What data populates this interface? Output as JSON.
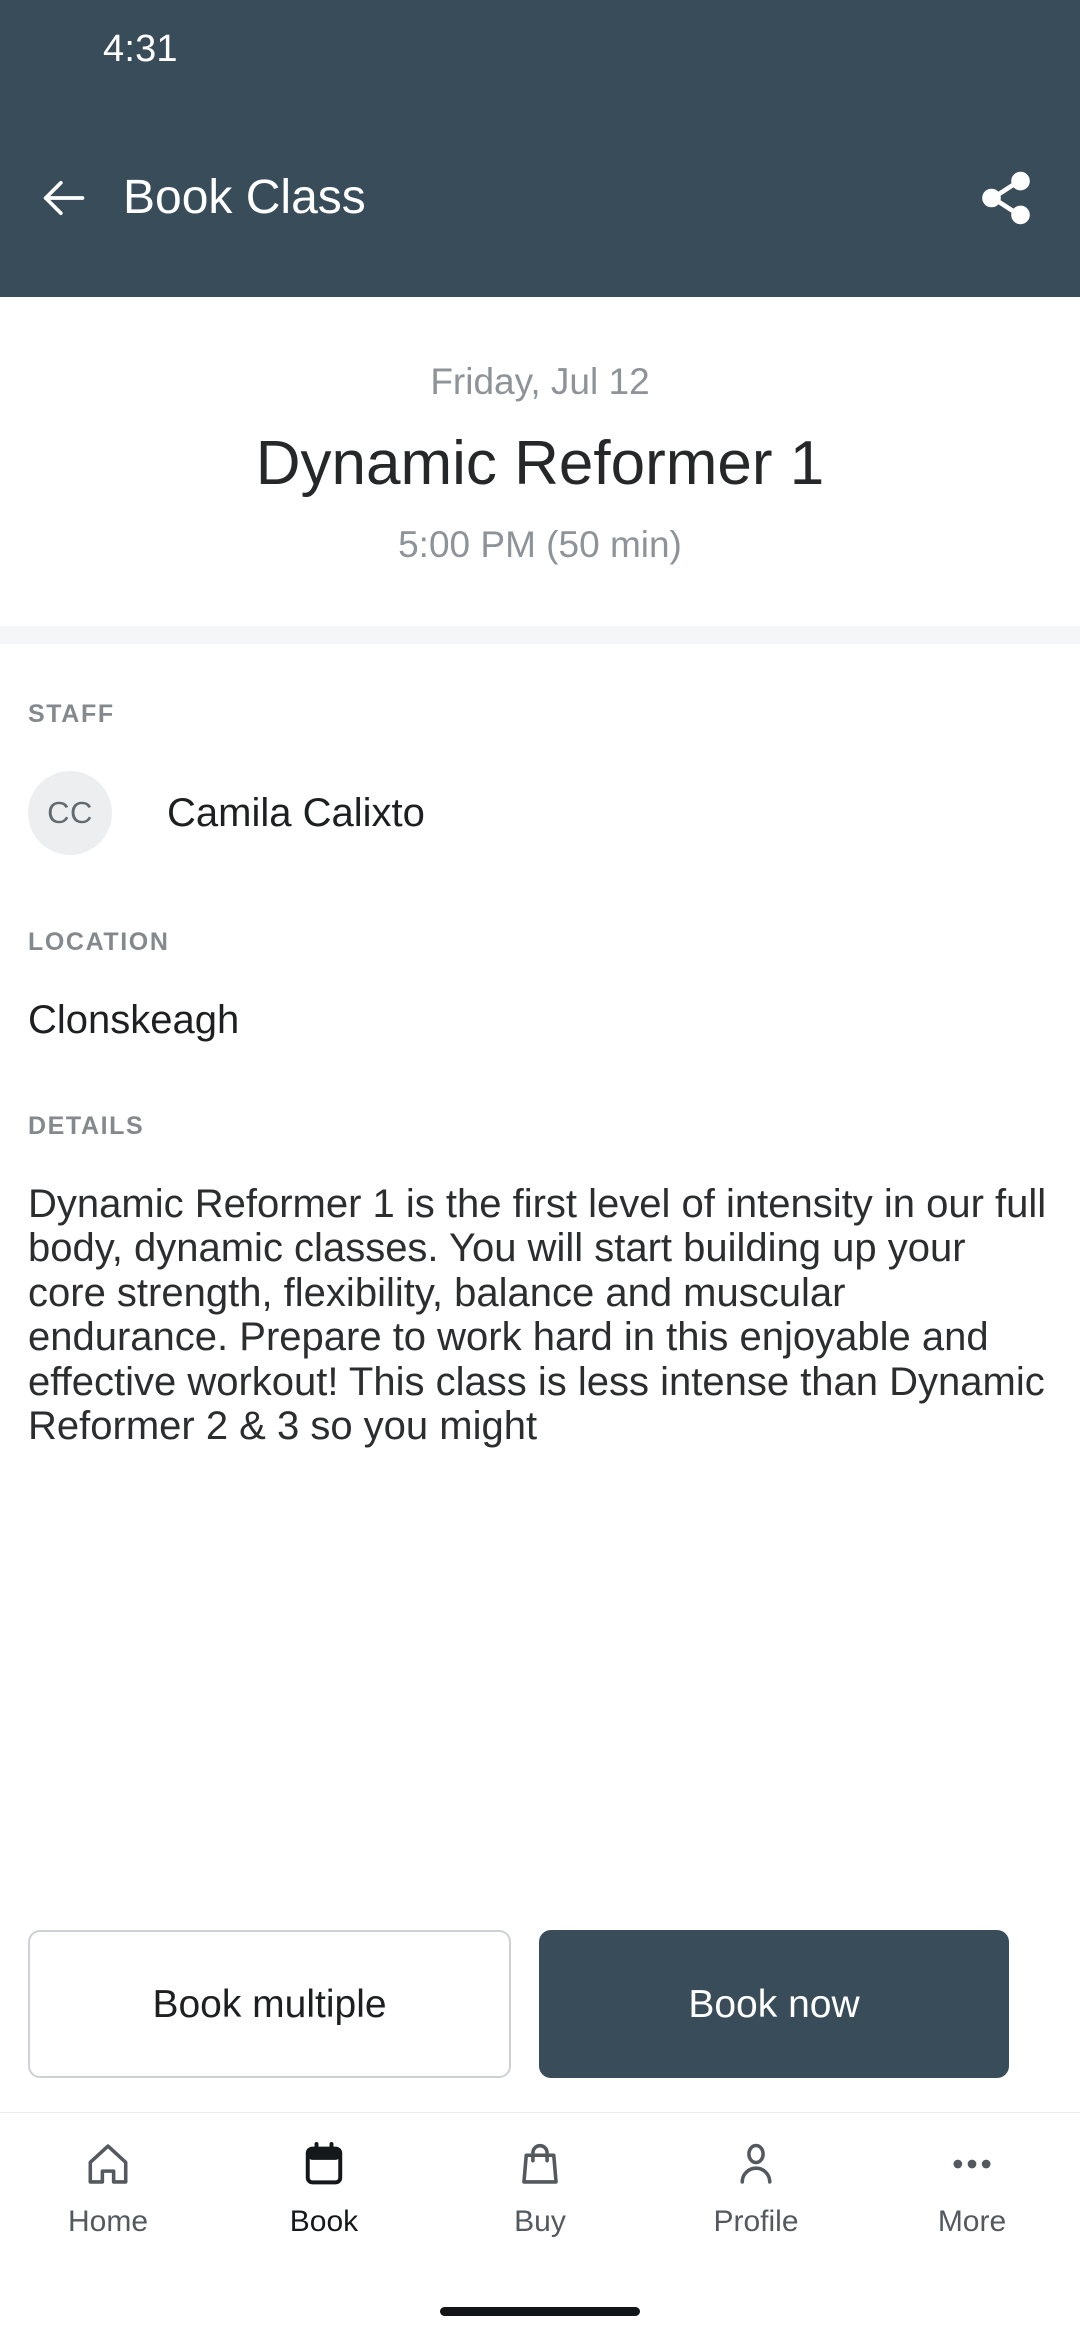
{
  "status_bar": {
    "time": "4:31"
  },
  "app_bar": {
    "title": "Book Class",
    "back_icon": "arrow-left-icon",
    "share_icon": "share-icon"
  },
  "class_summary": {
    "date": "Friday, Jul 12",
    "name": "Dynamic Reformer 1",
    "time": "5:00 PM (50 min)"
  },
  "staff": {
    "label": "STAFF",
    "avatar_initials": "CC",
    "name": "Camila Calixto"
  },
  "location": {
    "label": "LOCATION",
    "value": "Clonskeagh"
  },
  "details": {
    "label": "DETAILS",
    "text": "Dynamic Reformer 1 is the first level of intensity in our full body, dynamic classes. You will start building up your core strength, flexibility, balance and muscular endurance. Prepare to work hard in this enjoyable and effective workout! This class is less intense than Dynamic Reformer 2 & 3 so you might"
  },
  "actions": {
    "secondary_label": "Book multiple",
    "primary_label": "Book now"
  },
  "bottom_nav": {
    "items": [
      {
        "label": "Home",
        "icon": "home-icon",
        "active": false
      },
      {
        "label": "Book",
        "icon": "calendar-icon",
        "active": true
      },
      {
        "label": "Buy",
        "icon": "shopping-bag-icon",
        "active": false
      },
      {
        "label": "Profile",
        "icon": "person-icon",
        "active": false
      },
      {
        "label": "More",
        "icon": "ellipsis-icon",
        "active": false
      }
    ]
  },
  "colors": {
    "brand_dark": "#394C5A",
    "surface": "#ffffff",
    "muted_text": "#8d9399",
    "label_text": "#84898e",
    "body_text": "#2b2d2f",
    "divider": "#f4f6f8",
    "avatar_bg": "#eceef0"
  }
}
